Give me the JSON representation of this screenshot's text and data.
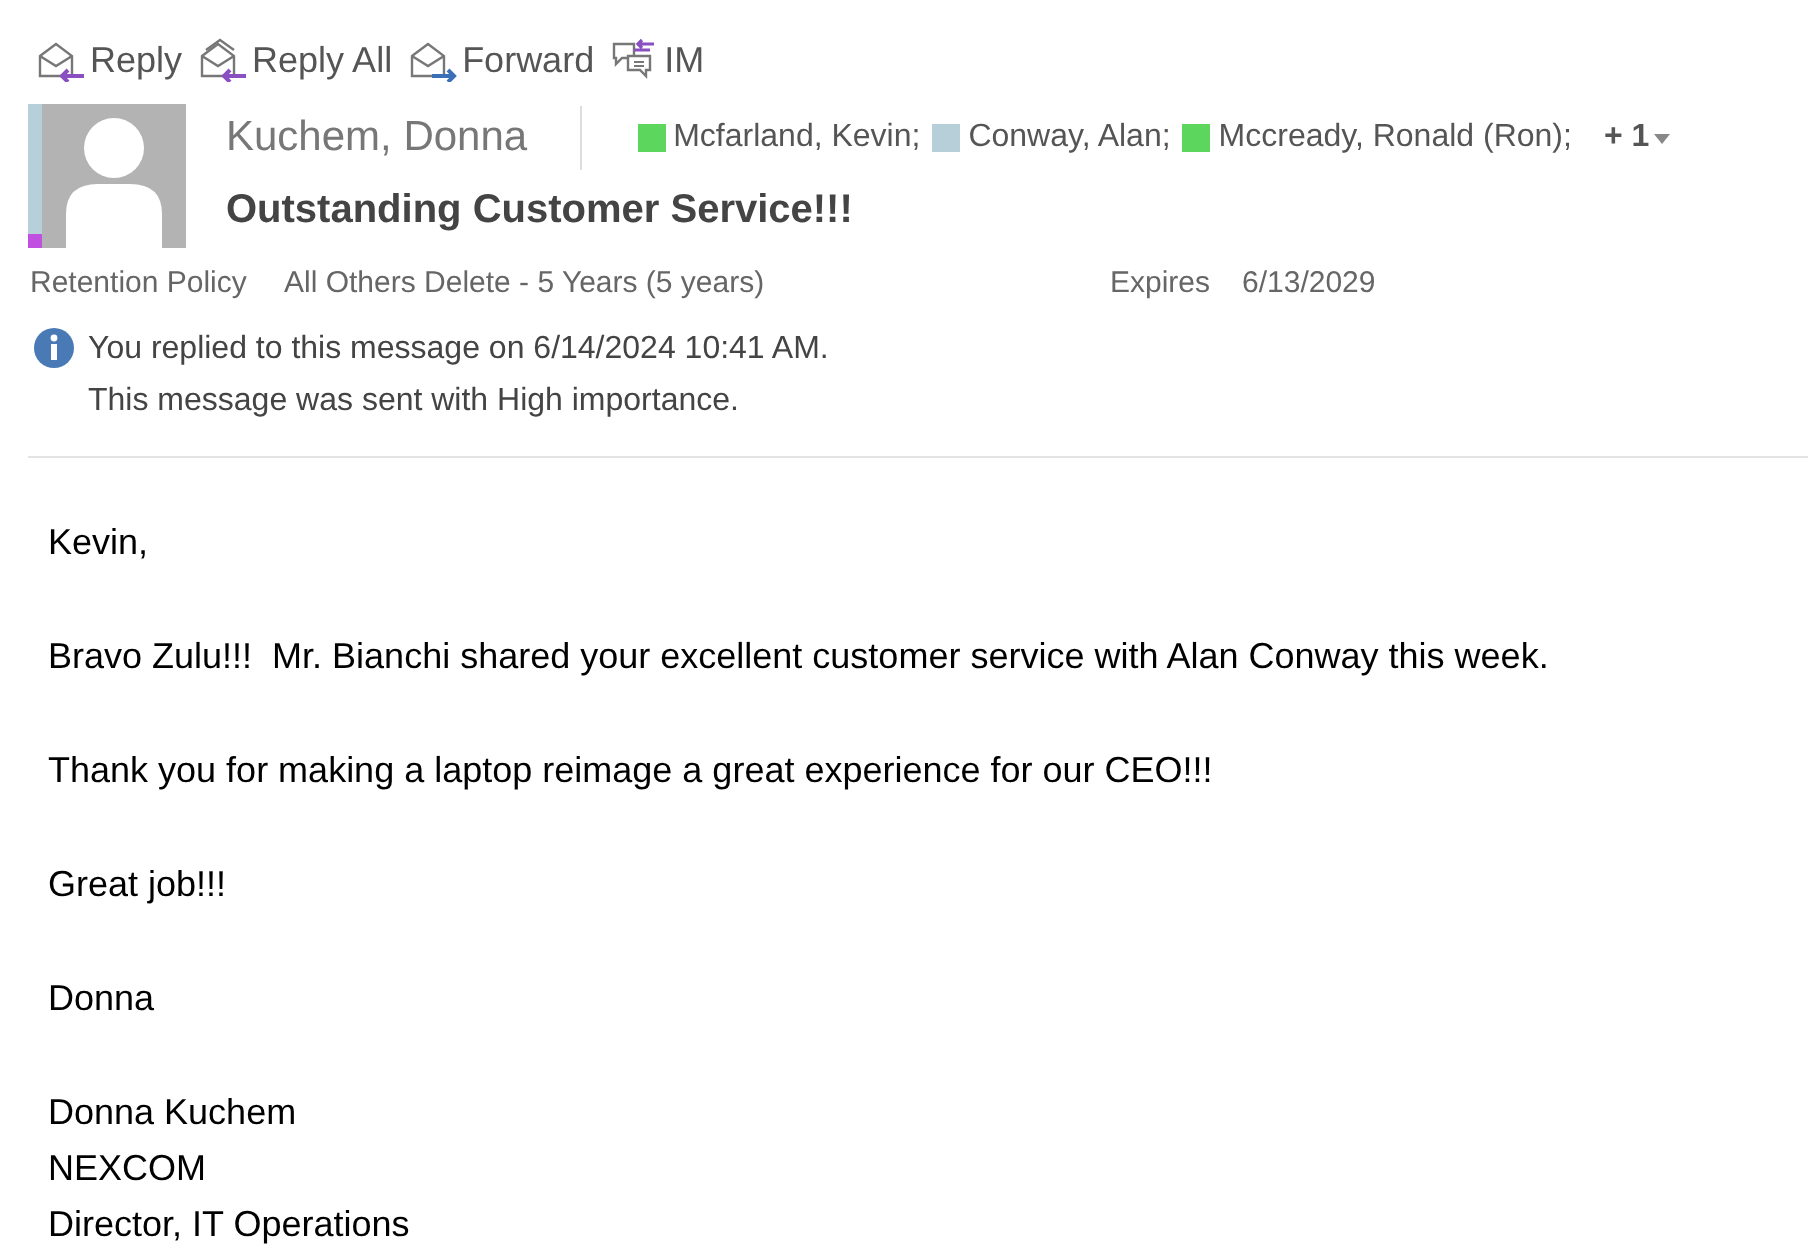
{
  "toolbar": [
    {
      "kind": "reply",
      "label": "Reply"
    },
    {
      "kind": "reply_all",
      "label": "Reply All"
    },
    {
      "kind": "forward",
      "label": "Forward"
    },
    {
      "kind": "im",
      "label": "IM"
    }
  ],
  "sender": {
    "name": "Kuchem, Donna",
    "color": "#b7cfd9"
  },
  "recipients": [
    {
      "name": "Mcfarland, Kevin;",
      "color": "#5cd65c"
    },
    {
      "name": "Conway, Alan;",
      "color": "#b7cfd9"
    },
    {
      "name": "Mccready, Ronald (Ron);",
      "color": "#5cd65c"
    }
  ],
  "more_recipients": "+ 1",
  "subject": "Outstanding Customer Service!!!",
  "retention": {
    "label": "Retention Policy",
    "value": "All Others Delete - 5 Years (5 years)",
    "expires_label": "Expires",
    "expires": "6/13/2029"
  },
  "info": [
    "You replied to this message on 6/14/2024 10:41 AM.",
    "This message was sent with High importance."
  ],
  "body": [
    [
      "Kevin,"
    ],
    [
      "Bravo Zulu!!!  Mr. Bianchi shared your excellent customer service with Alan Conway this week."
    ],
    [
      "Thank you for making a laptop reimage a great experience for our CEO!!!"
    ],
    [
      "Great job!!!"
    ],
    [
      "Donna"
    ],
    [
      "Donna Kuchem",
      "NEXCOM",
      "Director, IT Operations"
    ]
  ]
}
